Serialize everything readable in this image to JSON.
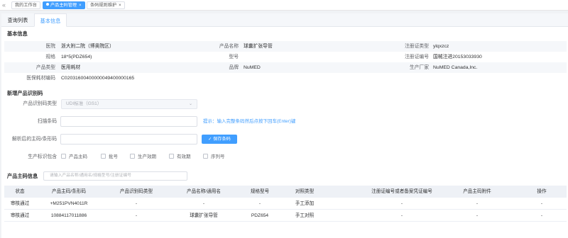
{
  "topbar": {
    "collapse_icon": "«",
    "tabs": [
      {
        "label": "我的工作台",
        "active": false
      },
      {
        "label": "产品主码管理",
        "active": true
      },
      {
        "label": "条码规则维护",
        "active": false
      }
    ]
  },
  "subtabs": [
    "查询列表",
    "基本信息"
  ],
  "basic_info": {
    "title": "基本信息",
    "rows": [
      [
        [
          "医院",
          "浙大附二院（博奥院区）"
        ],
        [
          "产品名称",
          "球囊扩张导管"
        ],
        [
          "注册证类型",
          "ylqxzcz"
        ]
      ],
      [
        [
          "规格",
          "18*5(PDZ654)"
        ],
        [
          "型号",
          ""
        ],
        [
          "注册证编号",
          "国械注进20153033930"
        ]
      ],
      [
        [
          "产品类型",
          "医用耗材"
        ],
        [
          "品牌",
          "NuMED"
        ],
        [
          "生产厂家",
          "NuMED Canada,Inc."
        ]
      ],
      [
        [
          "医保耗材编码",
          "C0203160040000004940000016​5"
        ]
      ]
    ]
  },
  "new_code": {
    "title": "新增产品识别码",
    "type_label": "产品识别码类型",
    "type_value": "UDI标准（GS1）",
    "scan_label": "扫描条码",
    "scan_hint": "提示：输入完整条码然后点按下回车(Enter)键",
    "parsed_label": "解析后的主码/条形码",
    "save_button": "✓ 保存条码",
    "include_label": "生产标识包含",
    "checkboxes": [
      "产品主码",
      "批号",
      "生产效期",
      "有效期",
      "序列号"
    ]
  },
  "product_code": {
    "title": "产品主码信息",
    "search_placeholder": "请输入产品名称/通用名/规格型号/注册证编号",
    "columns": [
      "状态",
      "产品主码/条形码",
      "产品识别码类型",
      "产品名称/通用名",
      "规格型号",
      "对照类型",
      "注册证编号或者备案凭证编号",
      "产品主码附件",
      "操作"
    ],
    "rows": [
      [
        "审核通过",
        "+M251PVN4011R",
        "-",
        "-",
        "-",
        "手工添加",
        "-",
        "-",
        "-"
      ],
      [
        "审核通过",
        "10884117011886",
        "-",
        "球囊扩张导管",
        "PDZ654",
        "手工对照",
        "-",
        "-",
        "-"
      ]
    ]
  }
}
